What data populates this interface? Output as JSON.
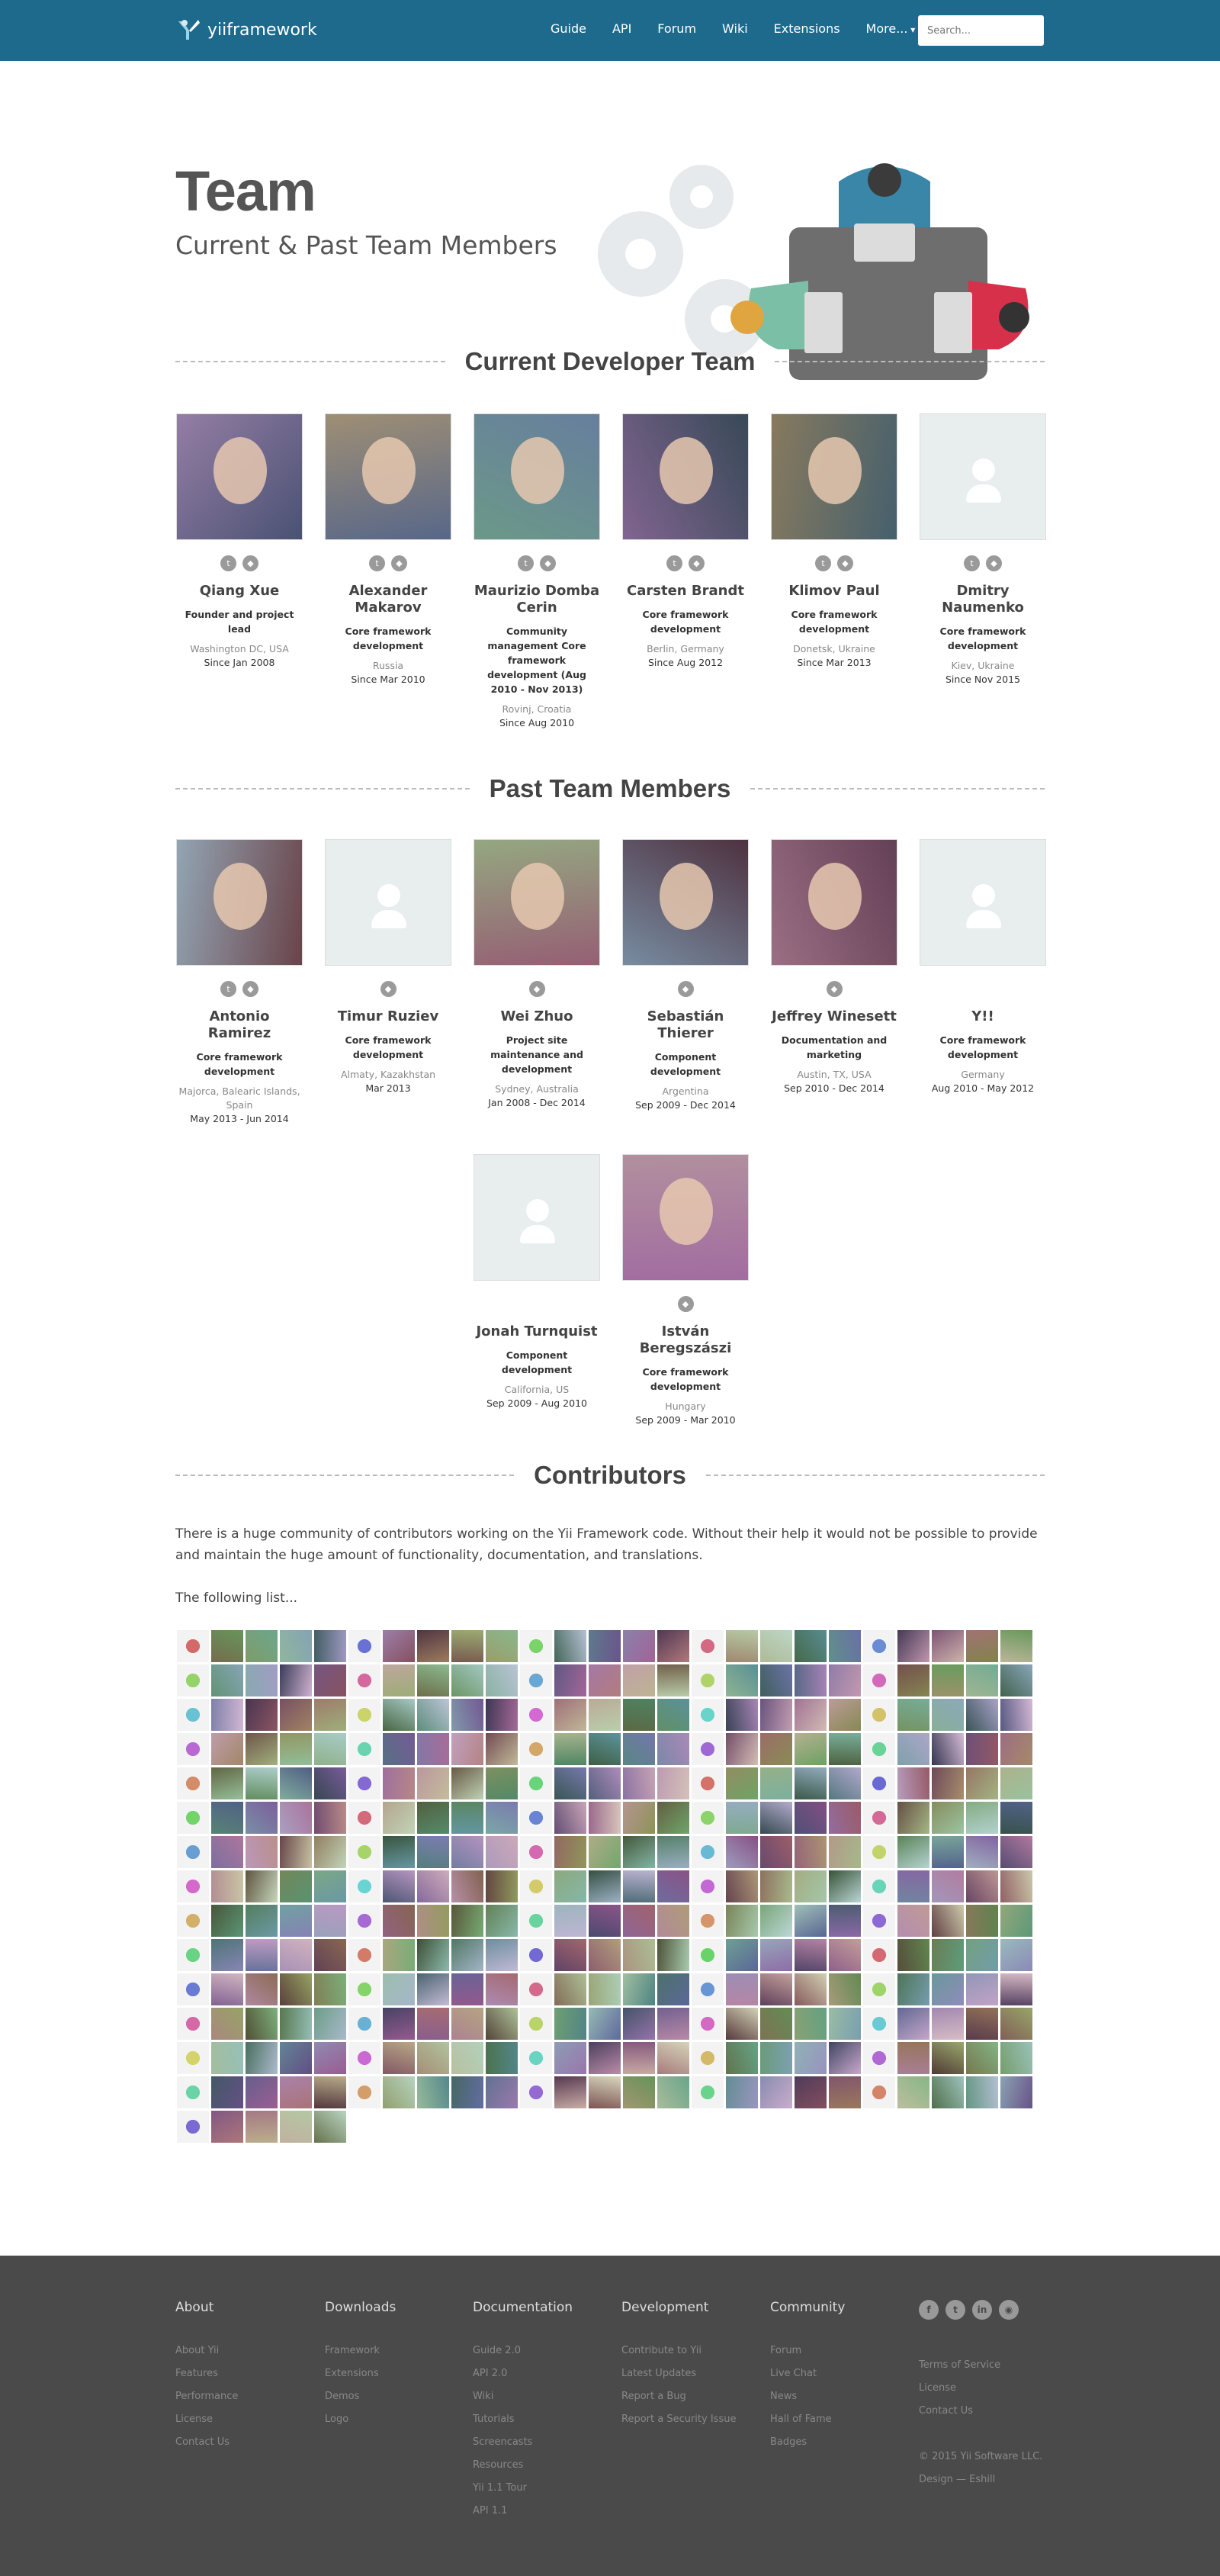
{
  "header": {
    "brand": "yiiframework",
    "nav": [
      "Guide",
      "API",
      "Forum",
      "Wiki",
      "Extensions",
      "More..."
    ],
    "search_placeholder": "Search..."
  },
  "hero": {
    "title": "Team",
    "subtitle": "Current & Past Team Members"
  },
  "sections": {
    "current": "Current Developer Team",
    "past": "Past Team Members",
    "contributors": "Contributors"
  },
  "current_team": [
    {
      "name": "Qiang Xue",
      "role": "Founder and project lead",
      "location": "Washington DC, USA",
      "since": "Since Jan 2008",
      "photo": "photo",
      "twitter": true,
      "github": true
    },
    {
      "name": "Alexander Makarov",
      "role": "Core framework development",
      "location": "Russia",
      "since": "Since Mar 2010",
      "photo": "photo",
      "twitter": true,
      "github": true
    },
    {
      "name": "Maurizio Domba Cerin",
      "role": "Community management Core framework development (Aug 2010 - Nov 2013)",
      "location": "Rovinj, Croatia",
      "since": "Since Aug 2010",
      "photo": "photo",
      "twitter": true,
      "github": true
    },
    {
      "name": "Carsten Brandt",
      "role": "Core framework development",
      "location": "Berlin, Germany",
      "since": "Since Aug 2012",
      "photo": "photo",
      "twitter": true,
      "github": true
    },
    {
      "name": "Klimov Paul",
      "role": "Core framework development",
      "location": "Donetsk, Ukraine",
      "since": "Since Mar 2013",
      "photo": "photo",
      "twitter": true,
      "github": true
    },
    {
      "name": "Dmitry Naumenko",
      "role": "Core framework development",
      "location": "Kiev, Ukraine",
      "since": "Since Nov 2015",
      "photo": "placeholder",
      "twitter": true,
      "github": true
    }
  ],
  "past_team": [
    {
      "name": "Antonio Ramirez",
      "role": "Core framework development",
      "location": "Majorca, Balearic Islands, Spain",
      "since": "May 2013 - Jun 2014",
      "photo": "photo",
      "twitter": true,
      "github": true
    },
    {
      "name": "Timur Ruziev",
      "role": "Core framework development",
      "location": "Almaty, Kazakhstan",
      "since": "Mar 2013",
      "photo": "placeholder",
      "twitter": false,
      "github": true
    },
    {
      "name": "Wei Zhuo",
      "role": "Project site maintenance and development",
      "location": "Sydney, Australia",
      "since": "Jan 2008 - Dec 2014",
      "photo": "photo",
      "twitter": false,
      "github": true
    },
    {
      "name": "Sebastián Thierer",
      "role": "Component development",
      "location": "Argentina",
      "since": "Sep 2009 - Dec 2014",
      "photo": "photo",
      "twitter": false,
      "github": true
    },
    {
      "name": "Jeffrey Winesett",
      "role": "Documentation and marketing",
      "location": "Austin, TX, USA",
      "since": "Sep 2010 - Dec 2014",
      "photo": "photo",
      "twitter": false,
      "github": true
    },
    {
      "name": "Y!!",
      "role": "Core framework development",
      "location": "Germany",
      "since": "Aug 2010 - May 2012",
      "photo": "placeholder",
      "twitter": false,
      "github": false
    },
    {
      "name": "Jonah Turnquist",
      "role": "Component development",
      "location": "California, US",
      "since": "Sep 2009 - Aug 2010",
      "photo": "placeholder",
      "twitter": false,
      "github": false
    },
    {
      "name": "István Beregszászi",
      "role": "Core framework development",
      "location": "Hungary",
      "since": "Sep 2009 - Mar 2010",
      "photo": "photo",
      "twitter": false,
      "github": true
    }
  ],
  "contributors": {
    "intro": "There is a huge community of contributors working on the Yii Framework code. Without their help it would not be possible to provide and maintain the huge amount of functionality, documentation, and translations.",
    "list_label": "The following list...",
    "avatar_count": 355
  },
  "footer": {
    "columns": [
      {
        "title": "About",
        "links": [
          "About Yii",
          "Features",
          "Performance",
          "License",
          "Contact Us"
        ]
      },
      {
        "title": "Downloads",
        "links": [
          "Framework",
          "Extensions",
          "Demos",
          "Logo"
        ]
      },
      {
        "title": "Documentation",
        "links": [
          "Guide 2.0",
          "API 2.0",
          "Wiki",
          "Tutorials",
          "Screencasts",
          "Resources",
          "Yii 1.1 Tour",
          "API 1.1"
        ]
      },
      {
        "title": "Development",
        "links": [
          "Contribute to Yii",
          "Latest Updates",
          "Report a Bug",
          "Report a Security Issue"
        ]
      },
      {
        "title": "Community",
        "links": [
          "Forum",
          "Live Chat",
          "News",
          "Hall of Fame",
          "Badges"
        ]
      }
    ],
    "social": [
      "facebook-icon",
      "twitter-icon",
      "linkedin-icon",
      "rss-icon"
    ],
    "legal": [
      "Terms of Service",
      "License",
      "Contact Us"
    ],
    "copyright": "© 2015 Yii Software LLC.",
    "design": "Design — Eshill"
  },
  "colors": {
    "header_bg": "#1e6a8d",
    "footer_bg": "#4a4a4a",
    "accent_red": "#d6304a",
    "accent_teal": "#7bbfa7"
  }
}
